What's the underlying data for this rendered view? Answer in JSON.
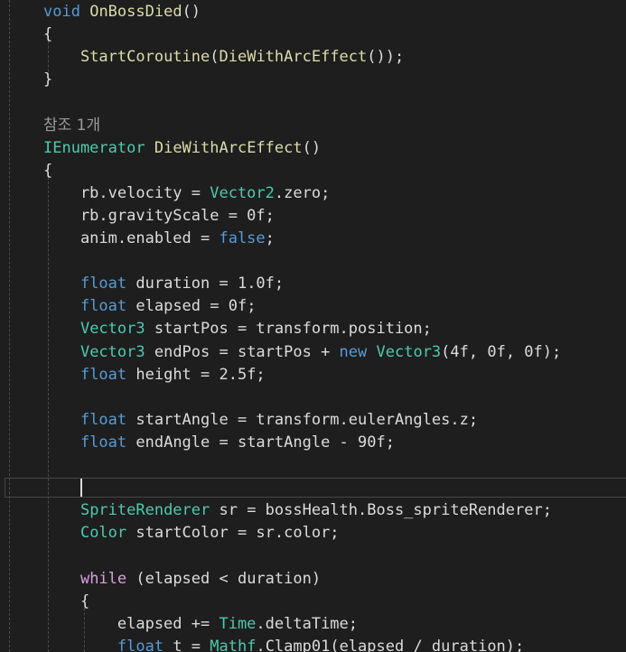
{
  "colors": {
    "background": "#1e1e1e",
    "keyword": "#569cd6",
    "type": "#4ec9b0",
    "method": "#dcdcaa",
    "control": "#d8a0df",
    "identifier": "#dcdcdc",
    "reference_hint": "#9a9a9a"
  },
  "code": {
    "ref_hint": "참조 1개",
    "lines": [
      [
        {
          "t": "void",
          "c": "kw"
        },
        {
          "t": " "
        },
        {
          "t": "OnBossDied",
          "c": "fn"
        },
        {
          "t": "()"
        }
      ],
      [
        {
          "t": "{"
        }
      ],
      [
        {
          "t": "    "
        },
        {
          "t": "StartCoroutine",
          "c": "fn"
        },
        {
          "t": "("
        },
        {
          "t": "DieWithArcEffect",
          "c": "fn"
        },
        {
          "t": "());"
        }
      ],
      [
        {
          "t": "}"
        }
      ],
      [],
      null,
      [
        {
          "t": "IEnumerator",
          "c": "ty"
        },
        {
          "t": " "
        },
        {
          "t": "DieWithArcEffect",
          "c": "fn"
        },
        {
          "t": "()"
        }
      ],
      [
        {
          "t": "{"
        }
      ],
      [
        {
          "t": "    rb.velocity = "
        },
        {
          "t": "Vector2",
          "c": "ty"
        },
        {
          "t": ".zero;"
        }
      ],
      [
        {
          "t": "    rb.gravityScale = 0f;"
        }
      ],
      [
        {
          "t": "    anim.enabled = "
        },
        {
          "t": "false",
          "c": "kw"
        },
        {
          "t": ";"
        }
      ],
      [],
      [
        {
          "t": "    "
        },
        {
          "t": "float",
          "c": "kw"
        },
        {
          "t": " duration = 1.0f;"
        }
      ],
      [
        {
          "t": "    "
        },
        {
          "t": "float",
          "c": "kw"
        },
        {
          "t": " elapsed = 0f;"
        }
      ],
      [
        {
          "t": "    "
        },
        {
          "t": "Vector3",
          "c": "ty"
        },
        {
          "t": " startPos = transform.position;"
        }
      ],
      [
        {
          "t": "    "
        },
        {
          "t": "Vector3",
          "c": "ty"
        },
        {
          "t": " endPos = startPos + "
        },
        {
          "t": "new",
          "c": "kw"
        },
        {
          "t": " "
        },
        {
          "t": "Vector3",
          "c": "ty"
        },
        {
          "t": "(4f, 0f, 0f);"
        }
      ],
      [
        {
          "t": "    "
        },
        {
          "t": "float",
          "c": "kw"
        },
        {
          "t": " height = 2.5f;"
        }
      ],
      [],
      [
        {
          "t": "    "
        },
        {
          "t": "float",
          "c": "kw"
        },
        {
          "t": " startAngle = transform.eulerAngles.z;"
        }
      ],
      [
        {
          "t": "    "
        },
        {
          "t": "float",
          "c": "kw"
        },
        {
          "t": " endAngle = startAngle - 90f;"
        }
      ],
      [],
      [],
      [
        {
          "t": "    "
        },
        {
          "t": "SpriteRenderer",
          "c": "ty"
        },
        {
          "t": " sr = bossHealth.Boss_spriteRenderer;"
        }
      ],
      [
        {
          "t": "    "
        },
        {
          "t": "Color",
          "c": "ty"
        },
        {
          "t": " startColor = sr.color;"
        }
      ],
      [],
      [
        {
          "t": "    "
        },
        {
          "t": "while",
          "c": "ctl"
        },
        {
          "t": " (elapsed < duration)"
        }
      ],
      [
        {
          "t": "    {"
        }
      ],
      [
        {
          "t": "        elapsed += "
        },
        {
          "t": "Time",
          "c": "ty"
        },
        {
          "t": ".deltaTime;"
        }
      ],
      [
        {
          "t": "        "
        },
        {
          "t": "float",
          "c": "kw"
        },
        {
          "t": " t = "
        },
        {
          "t": "Mathf",
          "c": "ty"
        },
        {
          "t": ".Clamp01(elapsed / duration);"
        }
      ]
    ]
  }
}
